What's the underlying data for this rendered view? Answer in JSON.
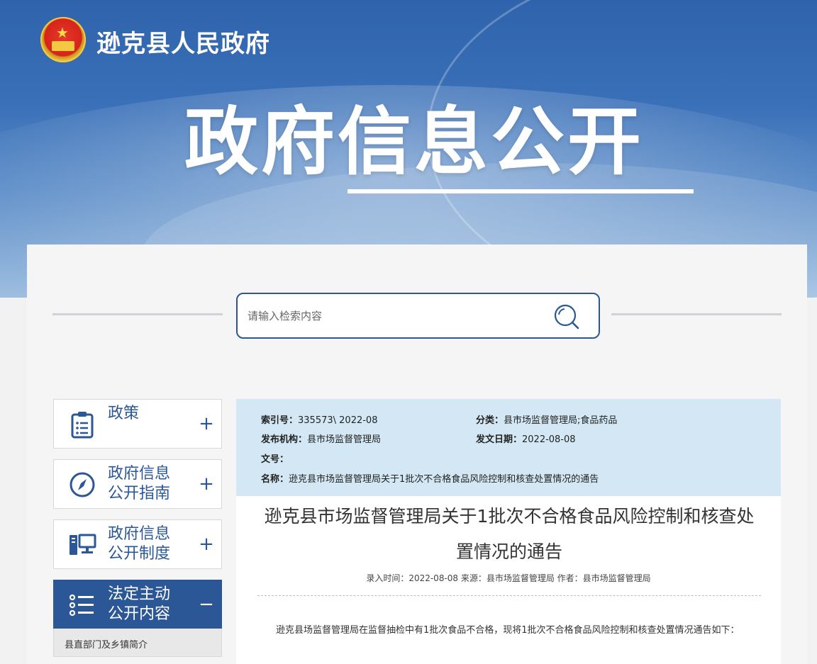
{
  "header": {
    "site_title": "逊克县人民政府",
    "hero_title": "政府信息公开"
  },
  "search": {
    "placeholder": "请输入检索内容"
  },
  "sidebar": {
    "items": [
      {
        "label_line1": "政策",
        "label_line2": "",
        "toggle": "+",
        "icon": "clipboard-list-icon"
      },
      {
        "label_line1": "政府信息",
        "label_line2": "公开指南",
        "toggle": "+",
        "icon": "compass-icon"
      },
      {
        "label_line1": "政府信息",
        "label_line2": "公开制度",
        "toggle": "+",
        "icon": "computer-icon"
      },
      {
        "label_line1": "法定主动",
        "label_line2": "公开内容",
        "toggle": "−",
        "icon": "list-icon"
      }
    ],
    "sub_items": [
      "县直部门及乡镇简介"
    ]
  },
  "meta": {
    "index_label": "索引号：",
    "index_value": "335573\\ 2022-08",
    "category_label": "分类：",
    "category_value": "县市场监督管理局;食品药品",
    "publisher_label": "发布机构：",
    "publisher_value": "县市场监督管理局",
    "date_label": "发文日期：",
    "date_value": "2022-08-08",
    "doc_no_label": "文号：",
    "doc_no_value": "",
    "name_label": "名称：",
    "name_value": "逊克县市场监督管理局关于1批次不合格食品风险控制和核查处置情况的通告"
  },
  "article": {
    "title": "逊克县市场监督管理局关于1批次不合格食品风险控制和核查处置情况的通告",
    "info": "录入时间：2022-08-08 来源：县市场监督管理局 作者：县市场监督管理局",
    "body": "逊克县场监督管理局在监督抽检中有1批次食品不合格，现将1批次不合格食品风险控制和核查处置情况通告如下："
  },
  "colors": {
    "primary": "#2b5797",
    "meta_bg": "#d3e8f4"
  }
}
